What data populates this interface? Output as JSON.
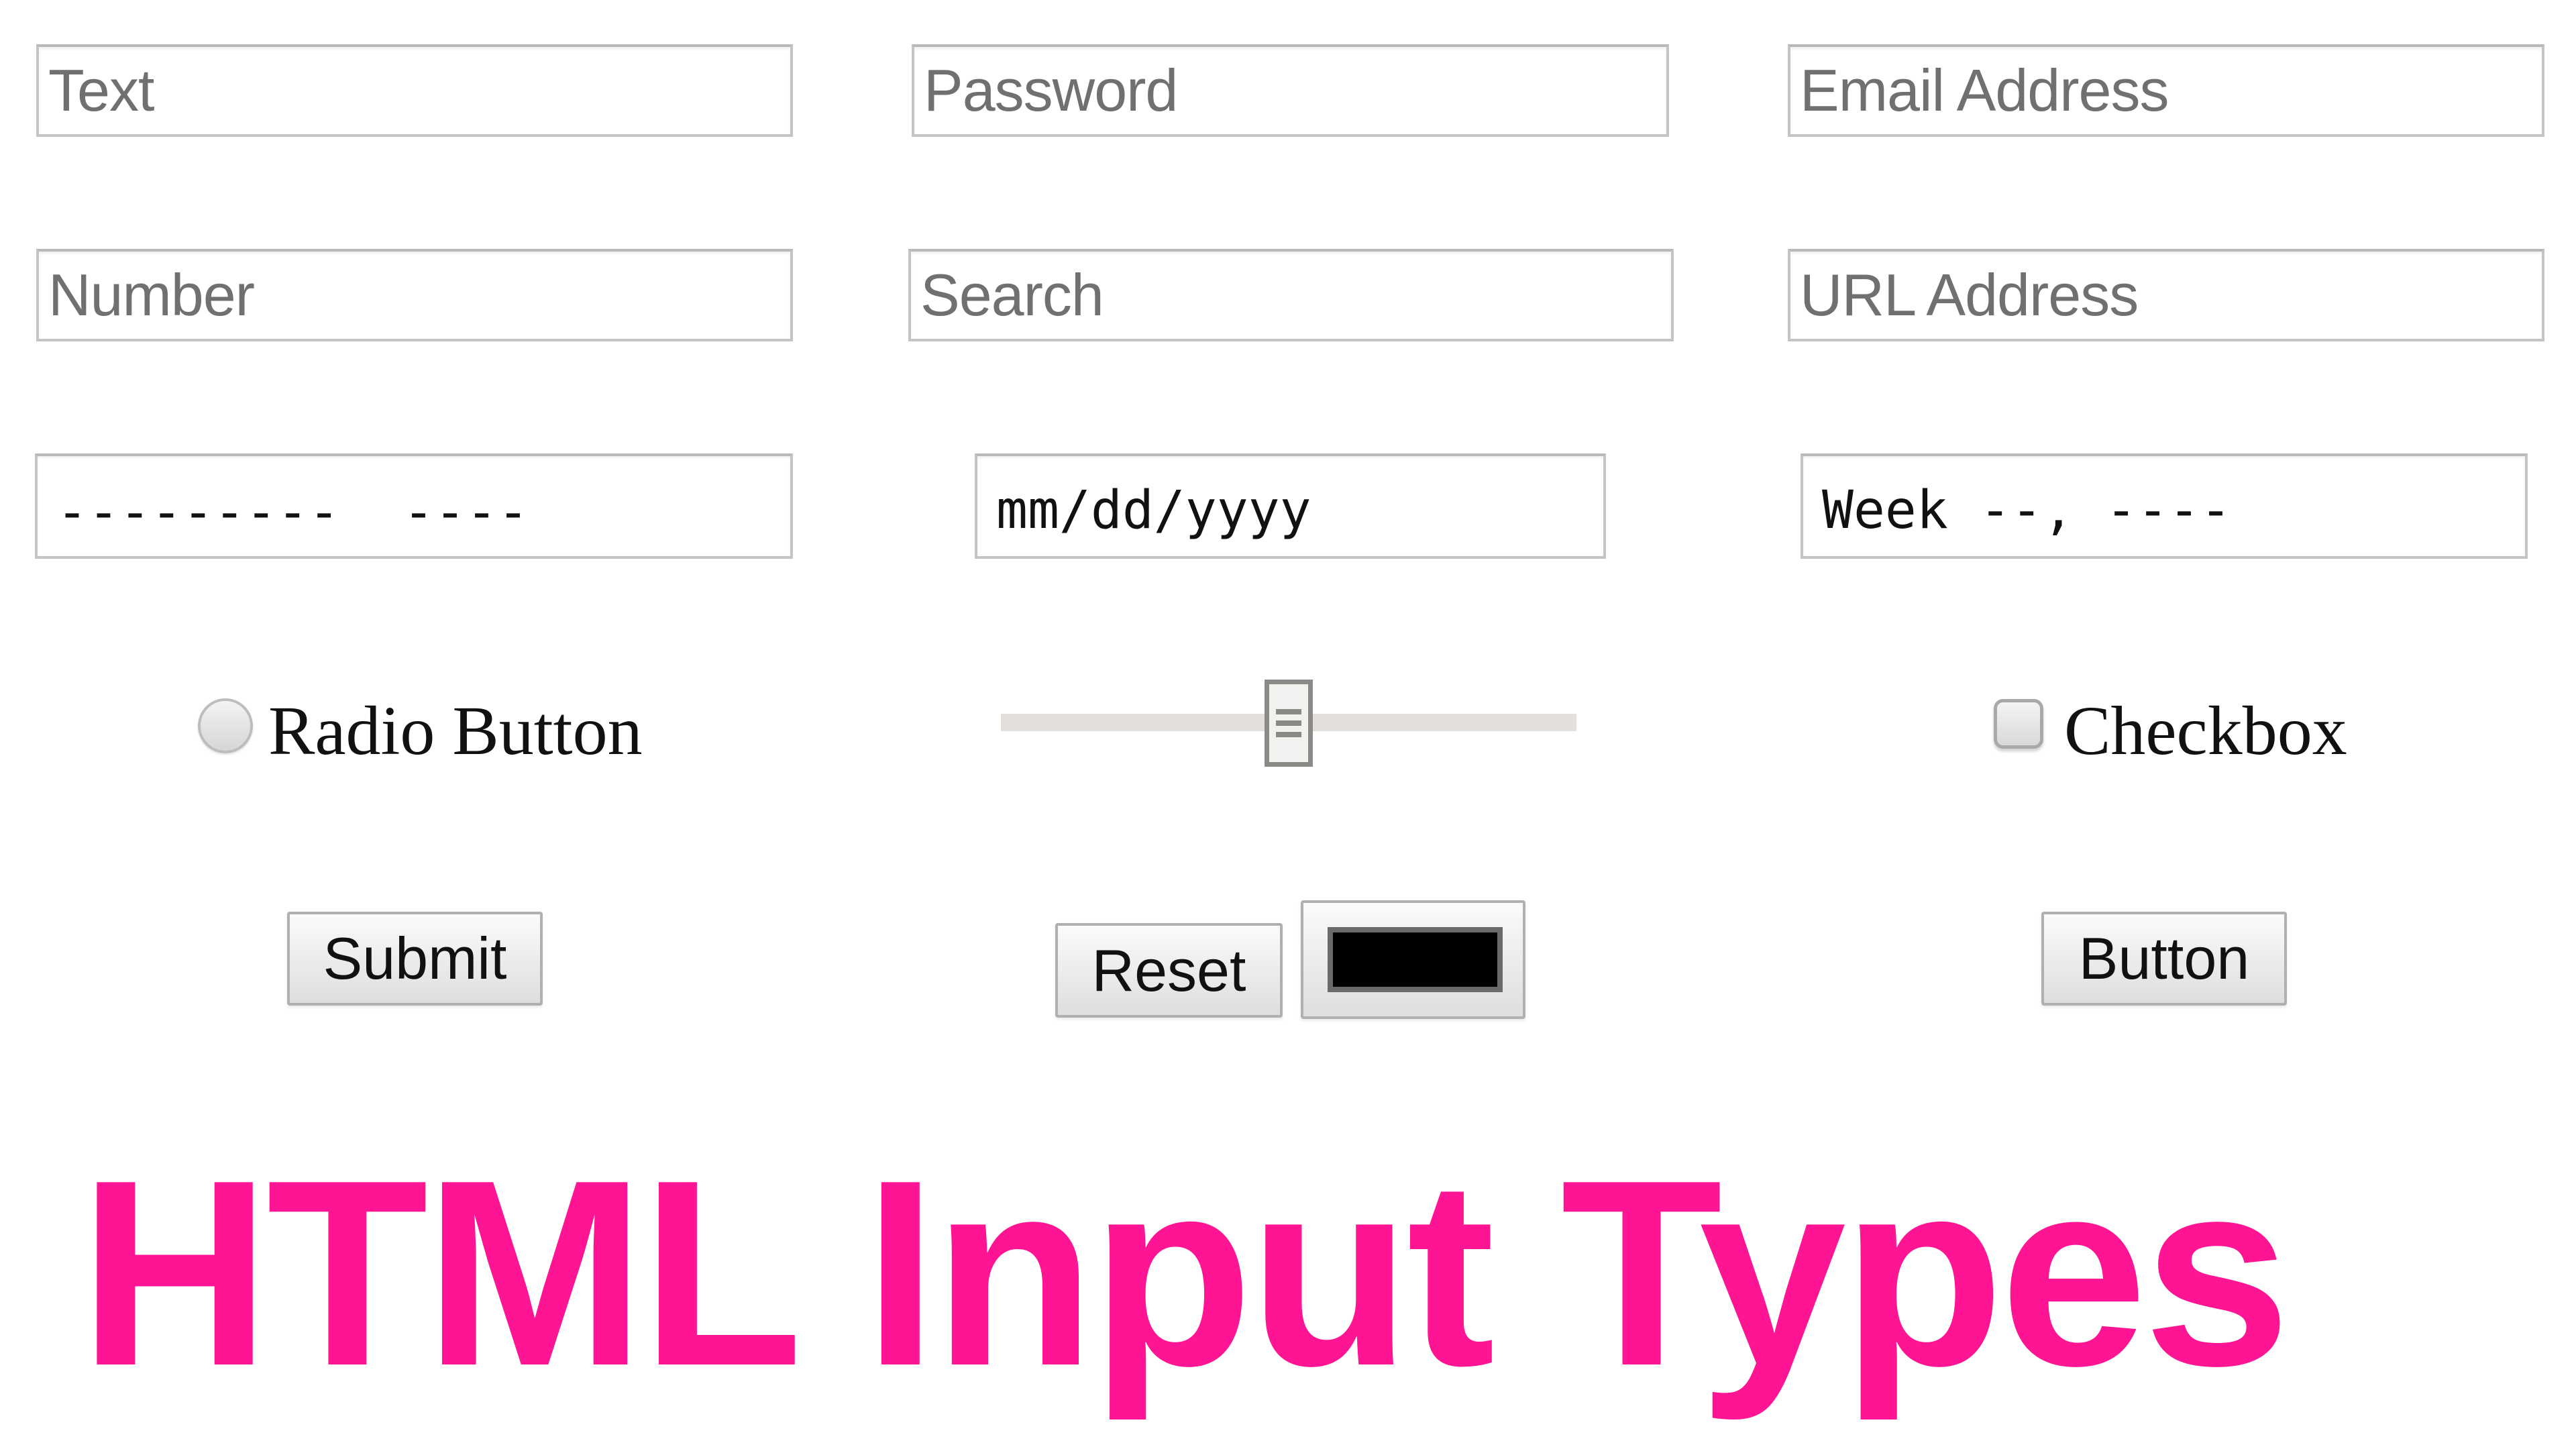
{
  "fields": {
    "text": {
      "type": "text",
      "placeholder": "Text"
    },
    "password": {
      "type": "password",
      "placeholder": "Password"
    },
    "email": {
      "type": "email",
      "placeholder": "Email Address"
    },
    "number": {
      "type": "number",
      "placeholder": "Number"
    },
    "search": {
      "type": "search",
      "placeholder": "Search"
    },
    "url": {
      "type": "url",
      "placeholder": "URL Address"
    },
    "month": {
      "type": "month",
      "display": "---------  ----"
    },
    "date": {
      "type": "date",
      "display": "mm/dd/yyyy"
    },
    "week": {
      "type": "week",
      "display": "Week --, ----"
    }
  },
  "radio": {
    "label": "Radio Button",
    "checked": false
  },
  "range": {
    "value_percent": 50
  },
  "checkbox": {
    "label": "Checkbox",
    "checked": false
  },
  "buttons": {
    "submit": "Submit",
    "reset": "Reset",
    "button": "Button"
  },
  "color_input": {
    "value": "#000000"
  },
  "heading": {
    "text": "HTML Input Types",
    "color": "#ff1493"
  }
}
